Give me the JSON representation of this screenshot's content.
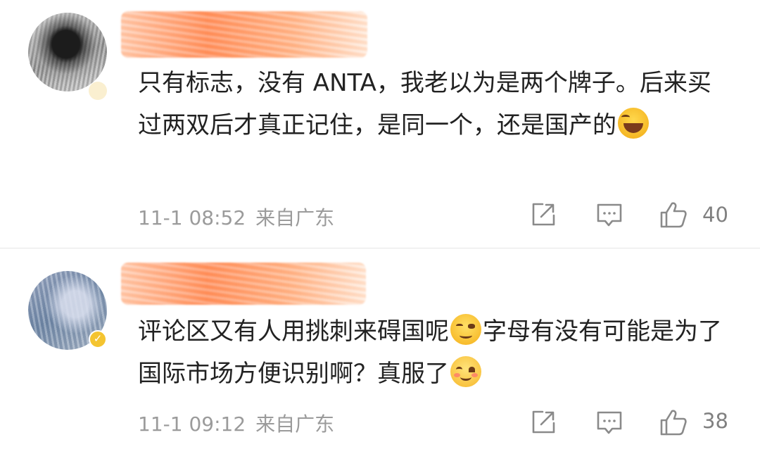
{
  "comments": [
    {
      "avatar": "avatar-photo-grayscale",
      "username_mask_color": "#ff8a4c",
      "text_before_emoji": "只有标志，没有 ANTA，我老以为是两个牌子。后来买过两双后才真正记住，是同一个，还是国产的",
      "emoji": "laughing-tears-emoji",
      "text_after_emoji": "",
      "time": "11-1 08:52",
      "location": "来自广东",
      "likes": "40",
      "icons": {
        "share": "share-icon",
        "reply": "comment-icon",
        "like": "thumbs-up-icon"
      }
    },
    {
      "avatar": "avatar-photo-blue",
      "verified_badge": "verified-badge-icon",
      "username_mask_color": "#ff8a4c",
      "text_before_emoji": "评论区又有人用挑刺来碍国呢",
      "emoji": "smirk-emoji",
      "text_after_emoji": "字母有没有可能是为了国际市场方便识别啊？真服了",
      "emoji_end": "smile-emoji",
      "time": "11-1 09:12",
      "location": "来自广东",
      "likes": "38",
      "icons": {
        "share": "share-icon",
        "reply": "comment-icon",
        "like": "thumbs-up-icon"
      }
    }
  ],
  "colors": {
    "text": "#222222",
    "meta": "#9b9b9b",
    "icon": "#8a8a8a",
    "verified": "#f4c430",
    "divider": "#e6e6e6"
  }
}
